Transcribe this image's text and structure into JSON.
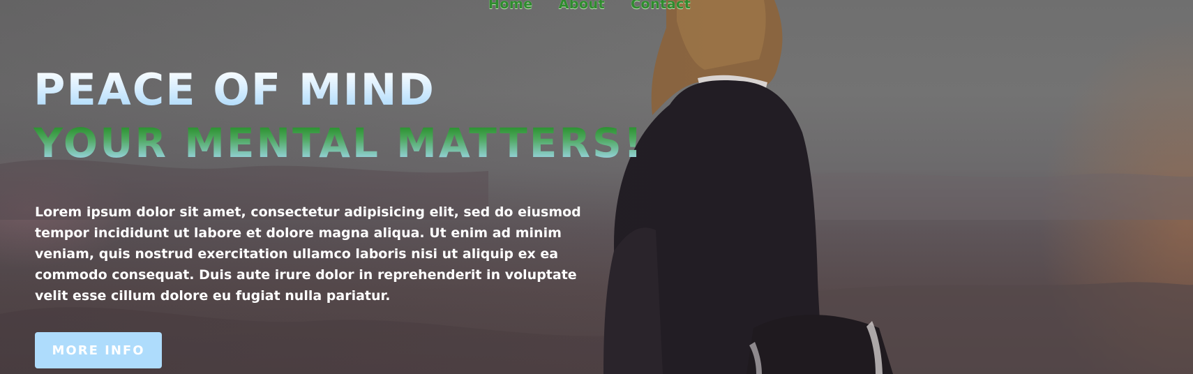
{
  "nav": {
    "items": [
      {
        "label": "Home"
      },
      {
        "label": "About"
      },
      {
        "label": "Contact"
      }
    ]
  },
  "hero": {
    "title": "PEACE OF MIND",
    "subtitle": "YOUR MENTAL MATTERS!",
    "body": "Lorem ipsum dolor sit amet, consectetur adipisicing elit, sed do eiusmod tempor incididunt ut labore et dolore magna aliqua. Ut enim ad minim veniam, quis nostrud exercitation ullamco laboris nisi ut aliquip ex ea commodo consequat. Duis aute irure dolor in reprehenderit in voluptate velit esse cillum dolore eu fugiat nulla pariatur.",
    "button_label": "MORE INFO",
    "background_image": "woman-sitting-on-mountain-at-dusk"
  },
  "colors": {
    "nav_link": "#2e8b2e",
    "title_gradient_top": "#ffffff",
    "title_gradient_bottom": "#a8d8fb",
    "subtitle_gradient_top": "#1f8a1f",
    "subtitle_gradient_bottom": "#a7dcf7",
    "button_bg": "#aedcfc",
    "body_text": "#ffffff"
  }
}
